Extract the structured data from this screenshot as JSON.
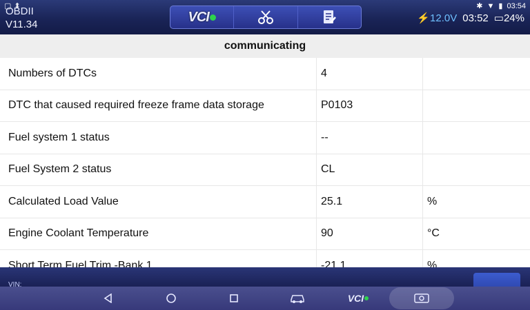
{
  "app": {
    "name": "OBDII",
    "version": "V11.34"
  },
  "status_bar": {
    "voltage": "12.0V",
    "time_app": "03:52",
    "battery": "24%",
    "time_system": "03:54"
  },
  "toolbar": {
    "vci_label": "VCI"
  },
  "section_title": "communicating",
  "rows": [
    {
      "name": "Numbers of DTCs",
      "value": "4",
      "unit": ""
    },
    {
      "name": "DTC that caused required freeze frame data storage",
      "value": "P0103",
      "unit": ""
    },
    {
      "name": "Fuel system 1 status",
      "value": "--",
      "unit": ""
    },
    {
      "name": "Fuel System 2 status",
      "value": "CL",
      "unit": ""
    },
    {
      "name": "Calculated Load Value",
      "value": "25.1",
      "unit": "%"
    },
    {
      "name": "Engine Coolant Temperature",
      "value": "90",
      "unit": "°C"
    },
    {
      "name": "Short Term Fuel Trim -Bank 1",
      "value": "-21.1",
      "unit": "%"
    }
  ],
  "footer": {
    "vin_label": "VIN:"
  },
  "navbar": {
    "vci_label": "VCI"
  },
  "colors": {
    "header": "#1a2457",
    "voltage": "#6fc0ff",
    "vci_dot": "#2ed34c"
  }
}
